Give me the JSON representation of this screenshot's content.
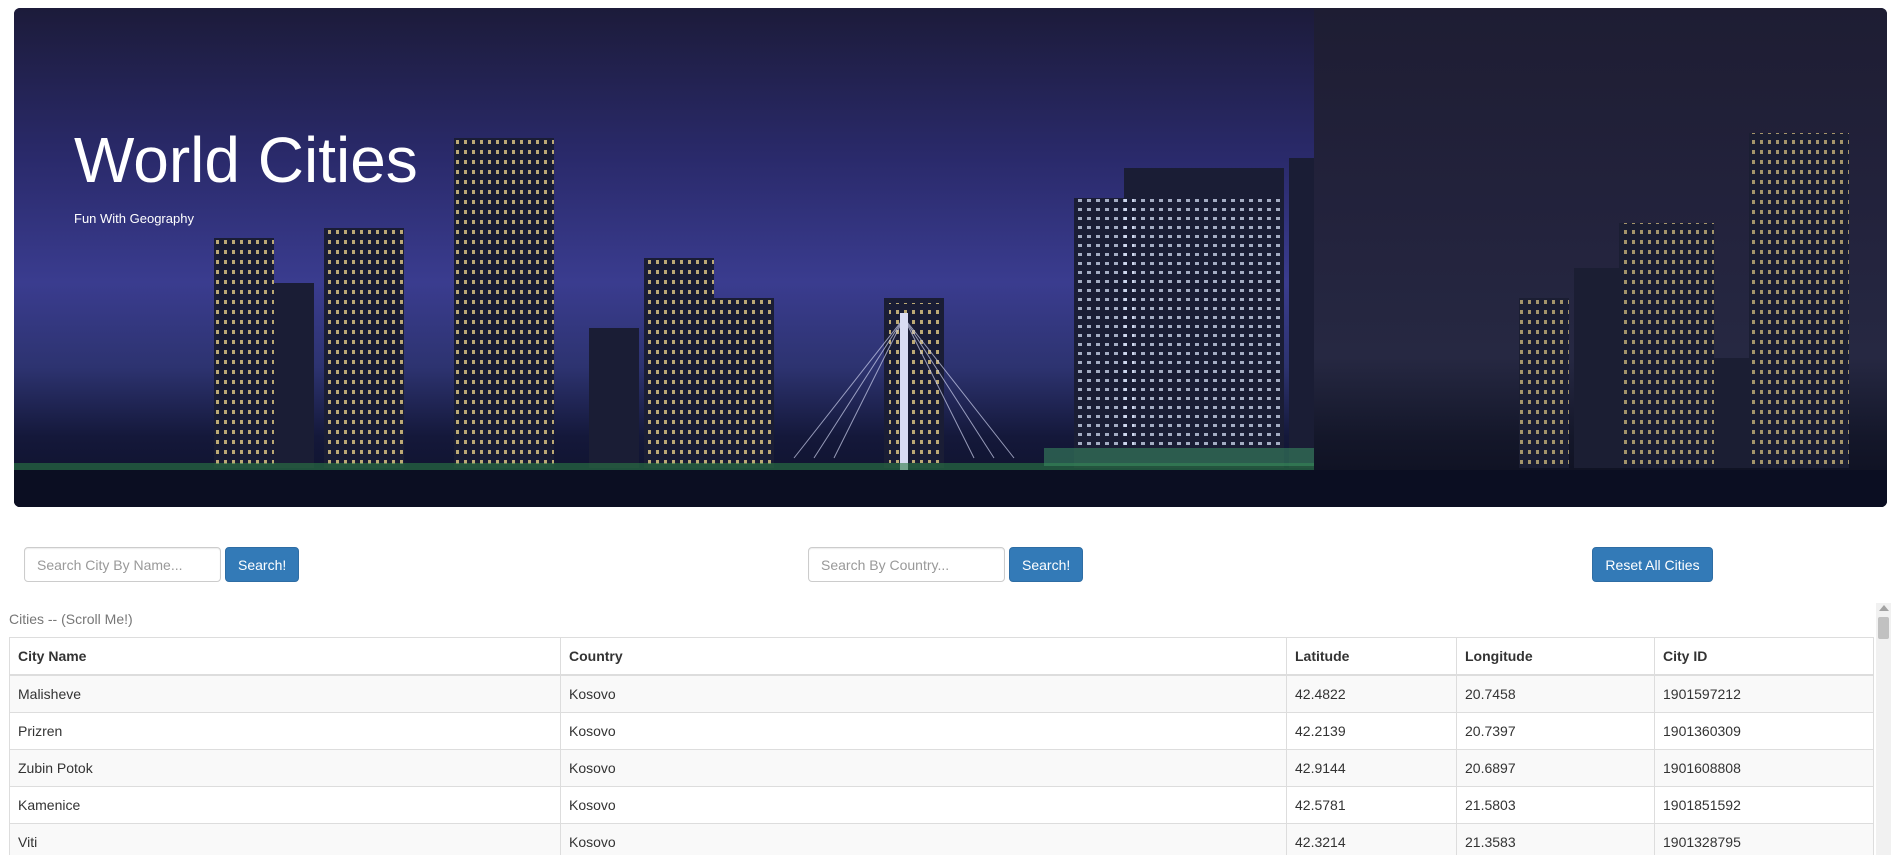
{
  "hero": {
    "title": "World Cities",
    "subtitle": "Fun With Geography"
  },
  "search_name": {
    "placeholder": "Search City By Name...",
    "button_label": "Search!"
  },
  "search_country": {
    "placeholder": "Search By Country...",
    "button_label": "Search!"
  },
  "reset_button_label": "Reset All Cities",
  "table": {
    "caption": "Cities -- (Scroll Me!)",
    "headers": [
      "City Name",
      "Country",
      "Latitude",
      "Longitude",
      "City ID"
    ],
    "rows": [
      [
        "Malisheve",
        "Kosovo",
        "42.4822",
        "20.7458",
        "1901597212"
      ],
      [
        "Prizren",
        "Kosovo",
        "42.2139",
        "20.7397",
        "1901360309"
      ],
      [
        "Zubin Potok",
        "Kosovo",
        "42.9144",
        "20.6897",
        "1901608808"
      ],
      [
        "Kamenice",
        "Kosovo",
        "42.5781",
        "21.5803",
        "1901851592"
      ],
      [
        "Viti",
        "Kosovo",
        "42.3214",
        "21.3583",
        "1901328795"
      ]
    ]
  },
  "colors": {
    "button": "#337ab7",
    "sky": "#2a2a6b"
  }
}
